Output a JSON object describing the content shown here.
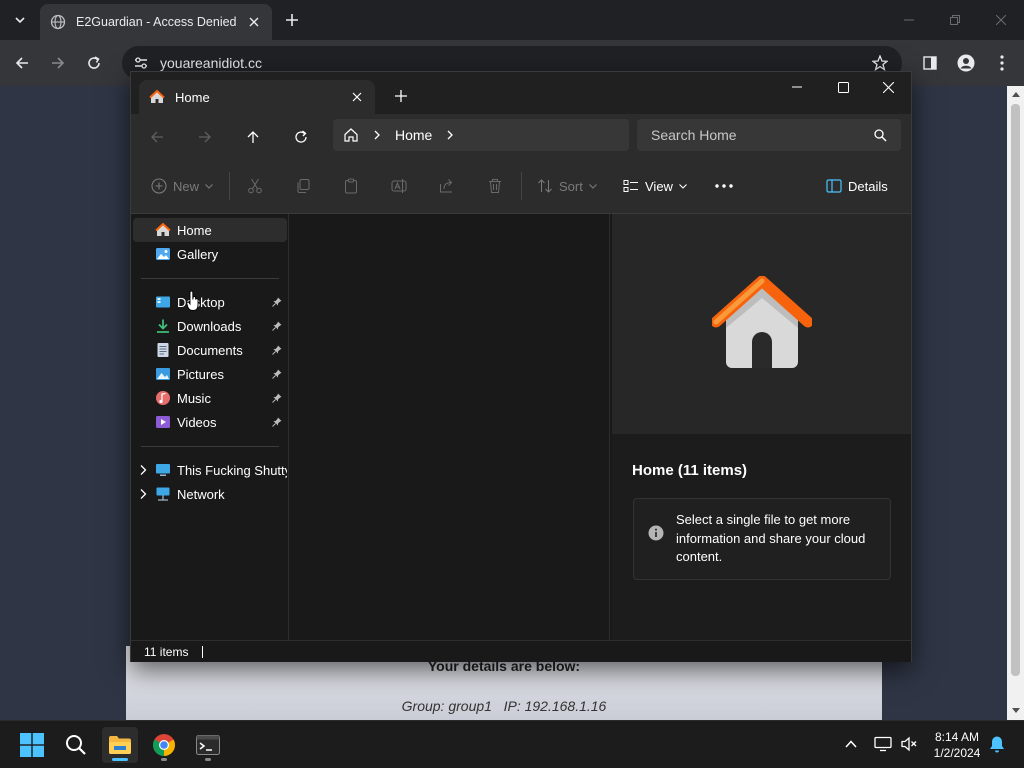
{
  "browser": {
    "tab_title": "E2Guardian - Access Denied",
    "url": "youareanidiot.cc"
  },
  "page": {
    "heading": "Your details are below:",
    "details": "Group: group1   IP: 192.168.1.16"
  },
  "explorer": {
    "tab_label": "Home",
    "breadcrumb": "Home",
    "search_placeholder": "Search Home",
    "commands": {
      "new": "New",
      "sort": "Sort",
      "view": "View",
      "details": "Details"
    },
    "sidebar": {
      "top": [
        {
          "label": "Home",
          "icon": "home-icon",
          "selected": true
        },
        {
          "label": "Gallery",
          "icon": "gallery-icon"
        }
      ],
      "pinned": [
        {
          "label": "Desktop",
          "icon": "desktop-icon"
        },
        {
          "label": "Downloads",
          "icon": "downloads-icon"
        },
        {
          "label": "Documents",
          "icon": "documents-icon"
        },
        {
          "label": "Pictures",
          "icon": "pictures-icon"
        },
        {
          "label": "Music",
          "icon": "music-icon"
        },
        {
          "label": "Videos",
          "icon": "videos-icon"
        }
      ],
      "drives": [
        {
          "label": "This Fucking Shutty PC",
          "icon": "this-pc-icon"
        },
        {
          "label": "Network",
          "icon": "network-icon"
        }
      ]
    },
    "details_pane": {
      "title": "Home (11 items)",
      "message": "Select a single file to get more information and share your cloud content."
    },
    "status": "11 items"
  },
  "taskbar": {
    "time": "8:14 AM",
    "date": "1/2/2024"
  },
  "colors": {
    "accent": "#4cc2ff",
    "home_orange": "#f7630c",
    "window_bg": "#191919"
  }
}
